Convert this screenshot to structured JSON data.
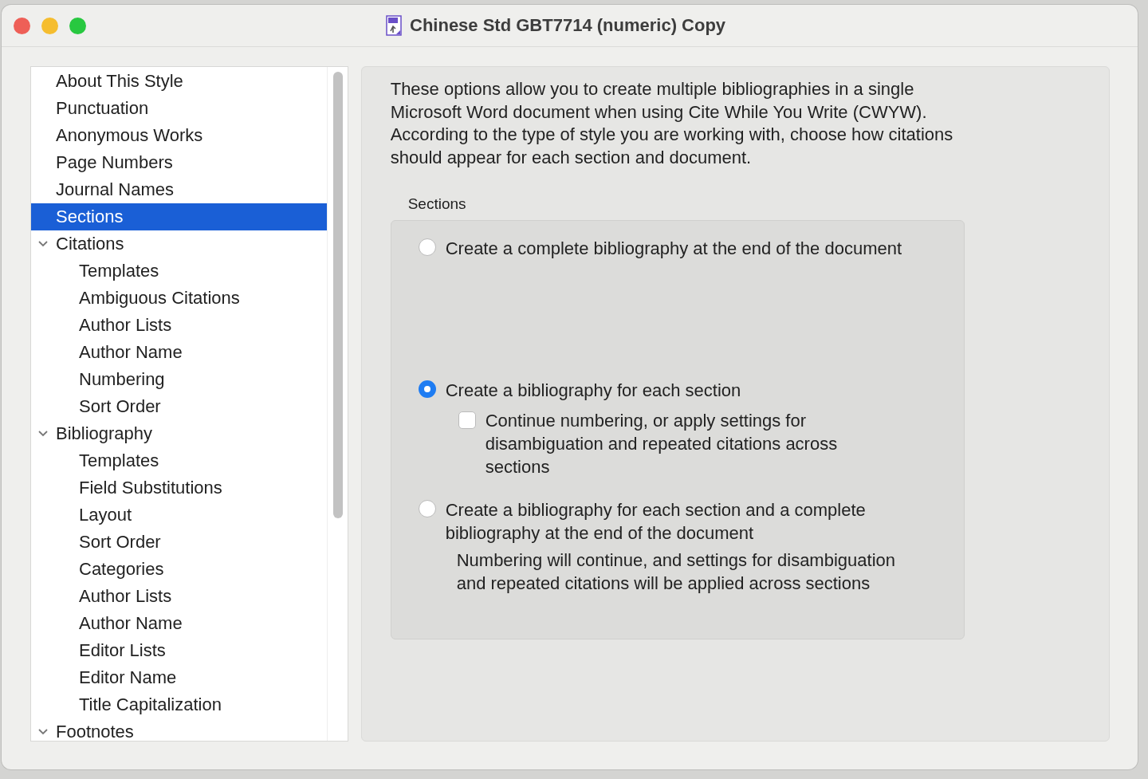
{
  "window": {
    "title": "Chinese Std GBT7714 (numeric) Copy"
  },
  "sidebar": {
    "items": [
      {
        "label": "About This Style",
        "selected": false
      },
      {
        "label": "Punctuation",
        "selected": false
      },
      {
        "label": "Anonymous Works",
        "selected": false
      },
      {
        "label": "Page Numbers",
        "selected": false
      },
      {
        "label": "Journal Names",
        "selected": false
      },
      {
        "label": "Sections",
        "selected": true
      },
      {
        "label": "Citations",
        "selected": false,
        "expanded": true,
        "children": [
          {
            "label": "Templates",
            "selected": false
          },
          {
            "label": "Ambiguous Citations",
            "selected": false
          },
          {
            "label": "Author Lists",
            "selected": false
          },
          {
            "label": "Author Name",
            "selected": false
          },
          {
            "label": "Numbering",
            "selected": false
          },
          {
            "label": "Sort Order",
            "selected": false
          }
        ]
      },
      {
        "label": "Bibliography",
        "selected": false,
        "expanded": true,
        "children": [
          {
            "label": "Templates",
            "selected": false
          },
          {
            "label": "Field Substitutions",
            "selected": false
          },
          {
            "label": "Layout",
            "selected": false
          },
          {
            "label": "Sort Order",
            "selected": false
          },
          {
            "label": "Categories",
            "selected": false
          },
          {
            "label": "Author Lists",
            "selected": false
          },
          {
            "label": "Author Name",
            "selected": false
          },
          {
            "label": "Editor Lists",
            "selected": false
          },
          {
            "label": "Editor Name",
            "selected": false
          },
          {
            "label": "Title Capitalization",
            "selected": false
          }
        ]
      },
      {
        "label": "Footnotes",
        "selected": false,
        "expanded": true
      }
    ]
  },
  "panel": {
    "intro": "These options allow you to create multiple bibliographies in a single Microsoft Word document when using Cite While You Write (CWYW). According to the type of style you are working with, choose how citations should appear for each section and document.",
    "group_label": "Sections",
    "options": [
      {
        "label": "Create a complete bibliography at the end of the document",
        "selected": false
      },
      {
        "label": "Create a bibliography for each section",
        "selected": true,
        "checkbox": {
          "label": "Continue numbering, or apply settings for disambiguation and repeated citations across sections",
          "checked": false
        }
      },
      {
        "label": "Create a bibliography for each section and a complete bibliography at the end of the document",
        "selected": false,
        "note": "Numbering will continue, and settings for disambiguation and repeated citations will be applied across sections"
      }
    ]
  }
}
